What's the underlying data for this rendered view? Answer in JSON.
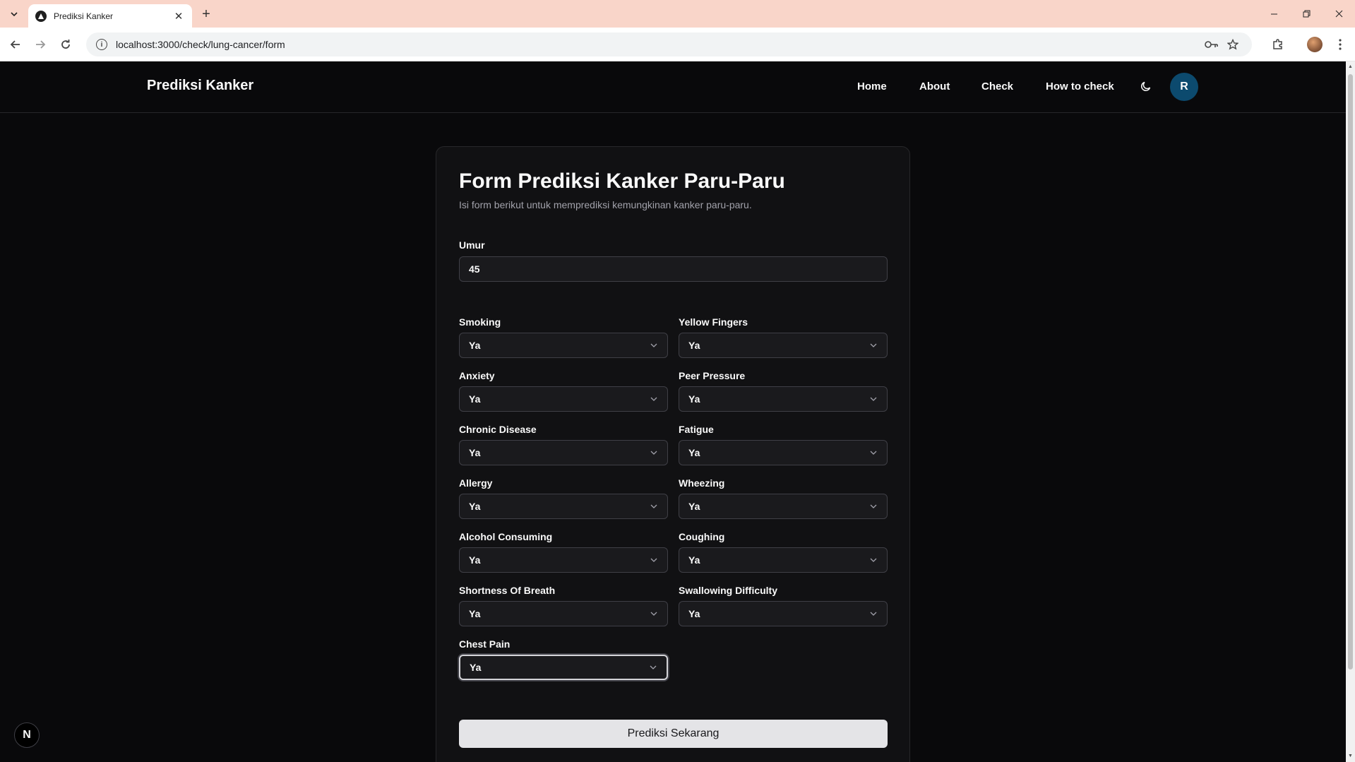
{
  "browser": {
    "tab_title": "Prediksi Kanker",
    "url": "localhost:3000/check/lung-cancer/form"
  },
  "header": {
    "brand": "Prediksi Kanker",
    "nav": [
      "Home",
      "About",
      "Check",
      "How to check"
    ],
    "avatar_initial": "R"
  },
  "form": {
    "title": "Form Prediksi Kanker Paru-Paru",
    "subtitle": "Isi form berikut untuk memprediksi kemungkinan kanker paru-paru.",
    "age_label": "Umur",
    "age_value": "45",
    "fields": [
      {
        "label": "Smoking",
        "value": "Ya"
      },
      {
        "label": "Yellow Fingers",
        "value": "Ya"
      },
      {
        "label": "Anxiety",
        "value": "Ya"
      },
      {
        "label": "Peer Pressure",
        "value": "Ya"
      },
      {
        "label": "Chronic Disease",
        "value": "Ya"
      },
      {
        "label": "Fatigue",
        "value": "Ya"
      },
      {
        "label": "Allergy",
        "value": "Ya"
      },
      {
        "label": "Wheezing",
        "value": "Ya"
      },
      {
        "label": "Alcohol Consuming",
        "value": "Ya"
      },
      {
        "label": "Coughing",
        "value": "Ya"
      },
      {
        "label": "Shortness Of Breath",
        "value": "Ya"
      },
      {
        "label": "Swallowing Difficulty",
        "value": "Ya"
      },
      {
        "label": "Chest Pain",
        "value": "Ya"
      }
    ],
    "submit_label": "Prediksi Sekarang"
  },
  "dev_badge": "N",
  "colors": {
    "background": "#09090b",
    "card": "#111113",
    "avatar": "#0c4a6e",
    "button": "#e4e4e7",
    "browser_frame": "#f9d5c9"
  }
}
